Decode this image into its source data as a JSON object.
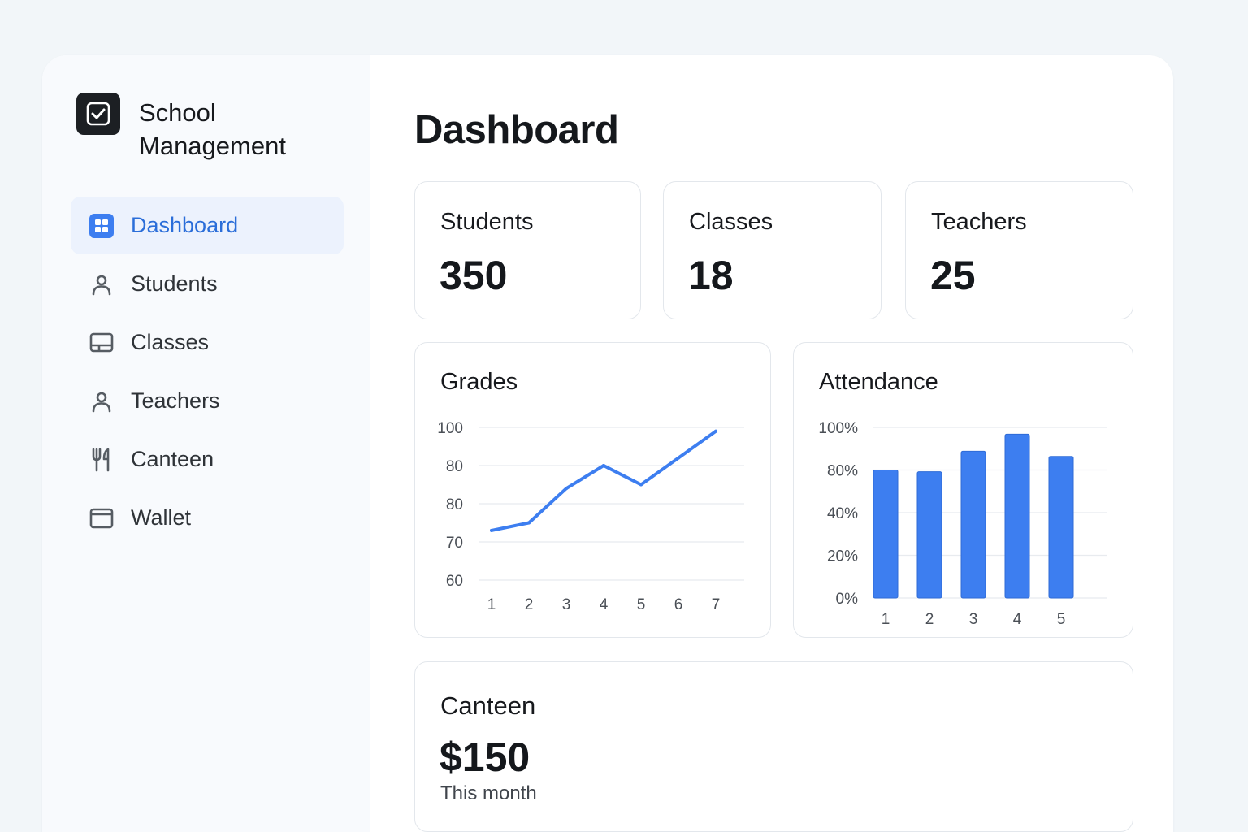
{
  "brand": {
    "title": "School Management",
    "logo_icon": "checkbox-icon"
  },
  "nav": {
    "items": [
      {
        "label": "Dashboard",
        "icon": "grid-icon",
        "active": true
      },
      {
        "label": "Students",
        "icon": "user-icon"
      },
      {
        "label": "Classes",
        "icon": "monitor-icon"
      },
      {
        "label": "Teachers",
        "icon": "user-icon"
      },
      {
        "label": "Canteen",
        "icon": "utensils-icon"
      },
      {
        "label": "Wallet",
        "icon": "wallet-icon"
      }
    ]
  },
  "page": {
    "title": "Dashboard"
  },
  "stats": [
    {
      "label": "Students",
      "value": "350"
    },
    {
      "label": "Classes",
      "value": "18"
    },
    {
      "label": "Teachers",
      "value": "25"
    }
  ],
  "canteen": {
    "label": "Canteen",
    "value": "$150",
    "subtitle": "This month"
  },
  "colors": {
    "accent": "#2b6ed9",
    "chart": "#3d7ef0"
  },
  "chart_data": [
    {
      "type": "line",
      "title": "Grades",
      "x": [
        1,
        2,
        3,
        4,
        5,
        6,
        7
      ],
      "y_tick_labels": [
        "100",
        "80",
        "80",
        "70",
        "60"
      ],
      "values": [
        73,
        75,
        84,
        90,
        85,
        92,
        99
      ],
      "grid": true
    },
    {
      "type": "bar",
      "title": "Attendance",
      "categories": [
        "1",
        "2",
        "3",
        "4",
        "5"
      ],
      "y_tick_labels": [
        "100%",
        "80%",
        "40%",
        "20%",
        "0%"
      ],
      "values": [
        75,
        74,
        86,
        96,
        83
      ],
      "ylim": [
        0,
        100
      ],
      "grid": true
    }
  ]
}
